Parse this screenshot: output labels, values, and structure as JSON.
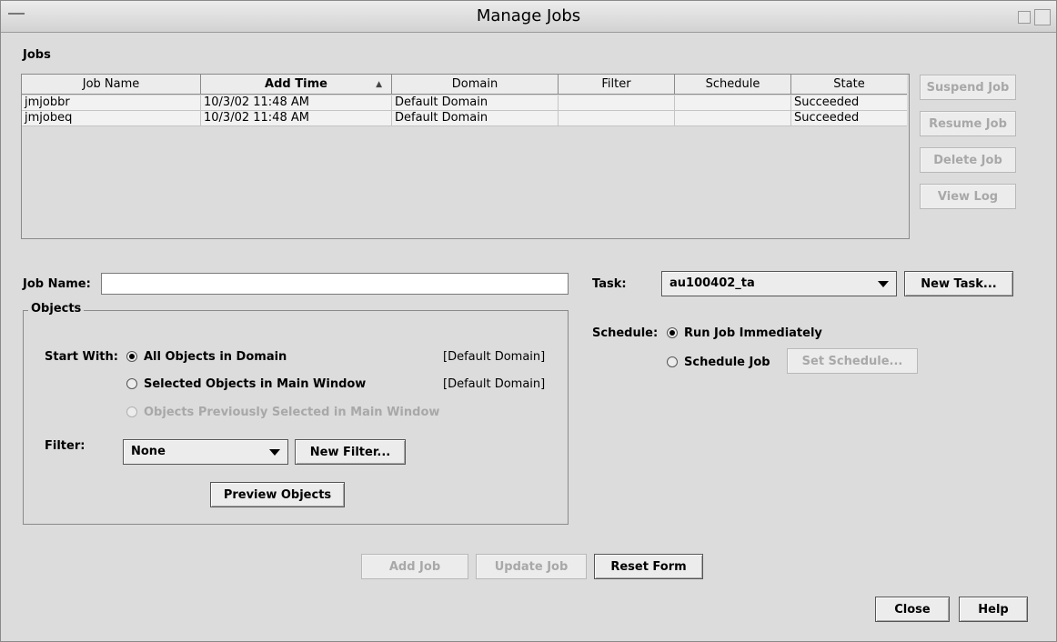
{
  "window": {
    "title": "Manage Jobs"
  },
  "jobs_section": {
    "label": "Jobs"
  },
  "table": {
    "columns": [
      "Job Name",
      "Add Time",
      "Domain",
      "Filter",
      "Schedule",
      "State"
    ],
    "sort_indicator": "▲",
    "rows": [
      [
        "jmjobbr",
        "10/3/02 11:48 AM",
        "Default Domain",
        "",
        "",
        "Succeeded"
      ],
      [
        "jmjobeq",
        "10/3/02 11:48 AM",
        "Default Domain",
        "",
        "",
        "Succeeded"
      ]
    ]
  },
  "side_buttons": {
    "suspend": "Suspend Job",
    "resume": "Resume Job",
    "delete": "Delete Job",
    "view_log": "View Log"
  },
  "form": {
    "job_name_label": "Job Name:",
    "job_name_value": "",
    "objects_label": "Objects",
    "start_with_label": "Start With:",
    "opt_all": "All Objects in Domain",
    "opt_all_domain": "[Default Domain]",
    "opt_selected": "Selected Objects in Main Window",
    "opt_selected_domain": "[Default Domain]",
    "opt_previous": "Objects Previously Selected in Main Window",
    "filter_label": "Filter:",
    "filter_value": "None",
    "new_filter": "New Filter...",
    "preview_objects": "Preview Objects",
    "task_label": "Task:",
    "task_value": "au100402_ta",
    "new_task": "New Task...",
    "schedule_label": "Schedule:",
    "run_immediately": "Run Job Immediately",
    "schedule_job": "Schedule Job",
    "set_schedule": "Set Schedule..."
  },
  "bottom_buttons": {
    "add_job": "Add Job",
    "update_job": "Update Job",
    "reset_form": "Reset Form",
    "close": "Close",
    "help": "Help"
  }
}
